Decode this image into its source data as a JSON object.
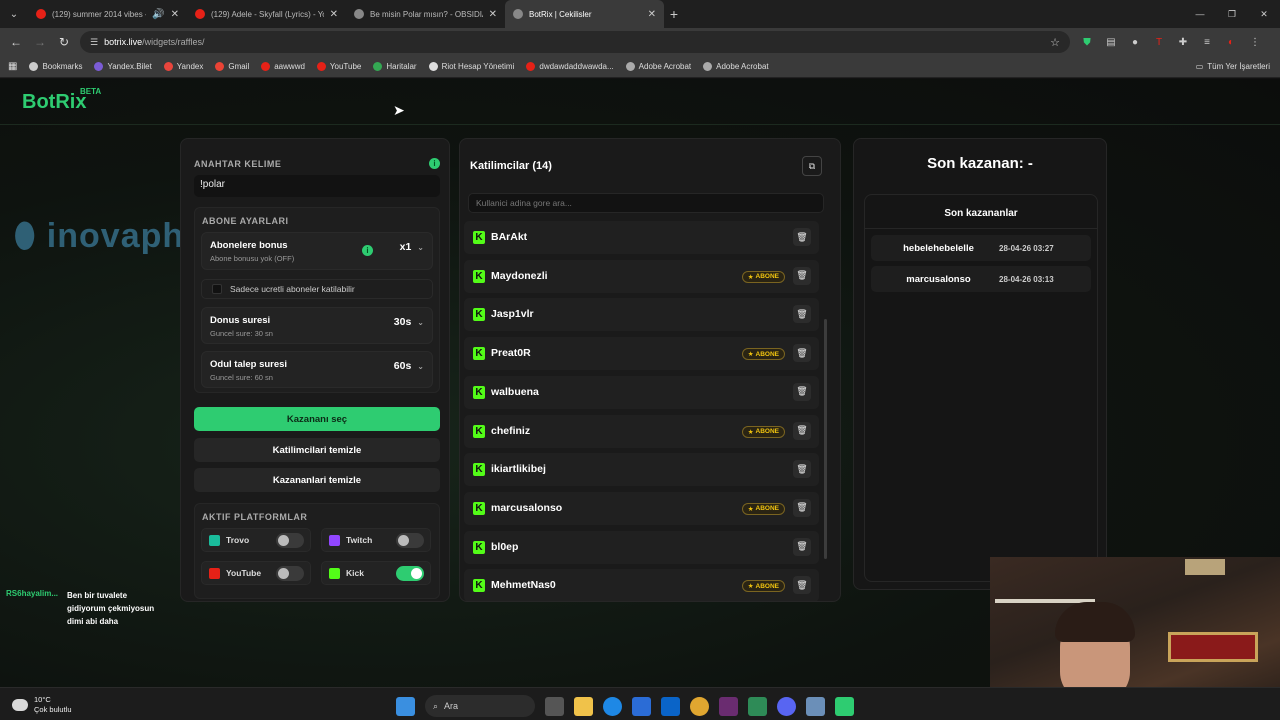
{
  "browser": {
    "tabs": [
      {
        "title": "(129) summer 2014 vibes -",
        "favicon_color": "#e62117",
        "active": false,
        "audio": true
      },
      {
        "title": "(129) Adele - Skyfall (Lyrics) - Yo",
        "favicon_color": "#e62117",
        "active": false,
        "audio": false
      },
      {
        "title": "Be misin Polar mısın? - OBSIDIA",
        "favicon_color": "#aaaaaa",
        "active": false,
        "audio": false
      },
      {
        "title": "BotRix | Cekilisler",
        "favicon_color": "#aaaaaa",
        "active": true,
        "audio": false
      }
    ],
    "url_host": "botrix.live",
    "url_path": "/widgets/raffles/",
    "bookmarks": [
      {
        "label": "Bookmarks",
        "color": "#cccccc"
      },
      {
        "label": "Yandex.Bilet",
        "color": "#7b5cd6"
      },
      {
        "label": "Yandex",
        "color": "#e8453c"
      },
      {
        "label": "Gmail",
        "color": "#ea4335"
      },
      {
        "label": "aawwwd",
        "color": "#e62117"
      },
      {
        "label": "YouTube",
        "color": "#e62117"
      },
      {
        "label": "Haritalar",
        "color": "#34a853"
      },
      {
        "label": "Riot Hesap Yönetimi",
        "color": "#dddddd"
      },
      {
        "label": "dwdawdaddwawda...",
        "color": "#e62117"
      },
      {
        "label": "Adobe Acrobat",
        "color": "#aaaaaa"
      },
      {
        "label": "Adobe Acrobat",
        "color": "#aaaaaa"
      }
    ],
    "all_bookmarks": "Tüm Yer İşaretleri"
  },
  "app": {
    "logo": "BotRix",
    "logo_badge": "BETA",
    "accent": "#2ecc71"
  },
  "settings": {
    "keyword_label": "ANAHTAR KELIME",
    "keyword_value": "!polar",
    "sub_settings_label": "ABONE AYARLARI",
    "sub_bonus_title": "Abonelere bonus",
    "sub_bonus_sub": "Abone bonusu yok (OFF)",
    "sub_bonus_value": "x1",
    "paid_subs_only": "Sadece ucretli aboneler katilabilir",
    "bonus_time_title": "Donus suresi",
    "bonus_time_sub": "Guncel sure: 30 sn",
    "bonus_time_value": "30s",
    "claim_time_title": "Odul talep suresi",
    "claim_time_sub": "Guncel sure: 60 sn",
    "claim_time_value": "60s",
    "pick_winner": "Kazananı seç",
    "clear_participants": "Katilimcilari temizle",
    "clear_winners": "Kazananlari temizle",
    "platforms_label": "AKTIF PLATFORMLAR",
    "platforms": [
      {
        "name": "Trovo",
        "color": "#1abc9c",
        "enabled": false
      },
      {
        "name": "Twitch",
        "color": "#9146ff",
        "enabled": false
      },
      {
        "name": "YouTube",
        "color": "#e62117",
        "enabled": false
      },
      {
        "name": "Kick",
        "color": "#53fc18",
        "enabled": true
      }
    ]
  },
  "participants": {
    "title": "Katilimcilar (14)",
    "search_placeholder": "Kullanici adina gore ara...",
    "subscriber_badge": "ABONE",
    "items": [
      {
        "name": "BArAkt",
        "subscriber": false
      },
      {
        "name": "Maydonezli",
        "subscriber": true
      },
      {
        "name": "Jasp1vlr",
        "subscriber": false
      },
      {
        "name": "Preat0R",
        "subscriber": true
      },
      {
        "name": "walbuena",
        "subscriber": false
      },
      {
        "name": "chefiniz",
        "subscriber": true
      },
      {
        "name": "ikiartlikibej",
        "subscriber": false
      },
      {
        "name": "marcusalonso",
        "subscriber": true
      },
      {
        "name": "bl0ep",
        "subscriber": false
      },
      {
        "name": "MehmetNas0",
        "subscriber": true
      }
    ]
  },
  "winners": {
    "title": "Son kazanan: -",
    "list_title": "Son kazananlar",
    "items": [
      {
        "name": "hebelehebelelle",
        "date": "28-04-26 03:27"
      },
      {
        "name": "marcusalonso",
        "date": "28-04-26 03:13"
      }
    ]
  },
  "chat": {
    "user": "RS6hayalim...",
    "message": "Ben bir tuvalete gidiyorum çekmiyosun dimi abi daha"
  },
  "taskbar": {
    "temp": "10°C",
    "weather": "Çok bulutlu",
    "search": "Ara"
  }
}
